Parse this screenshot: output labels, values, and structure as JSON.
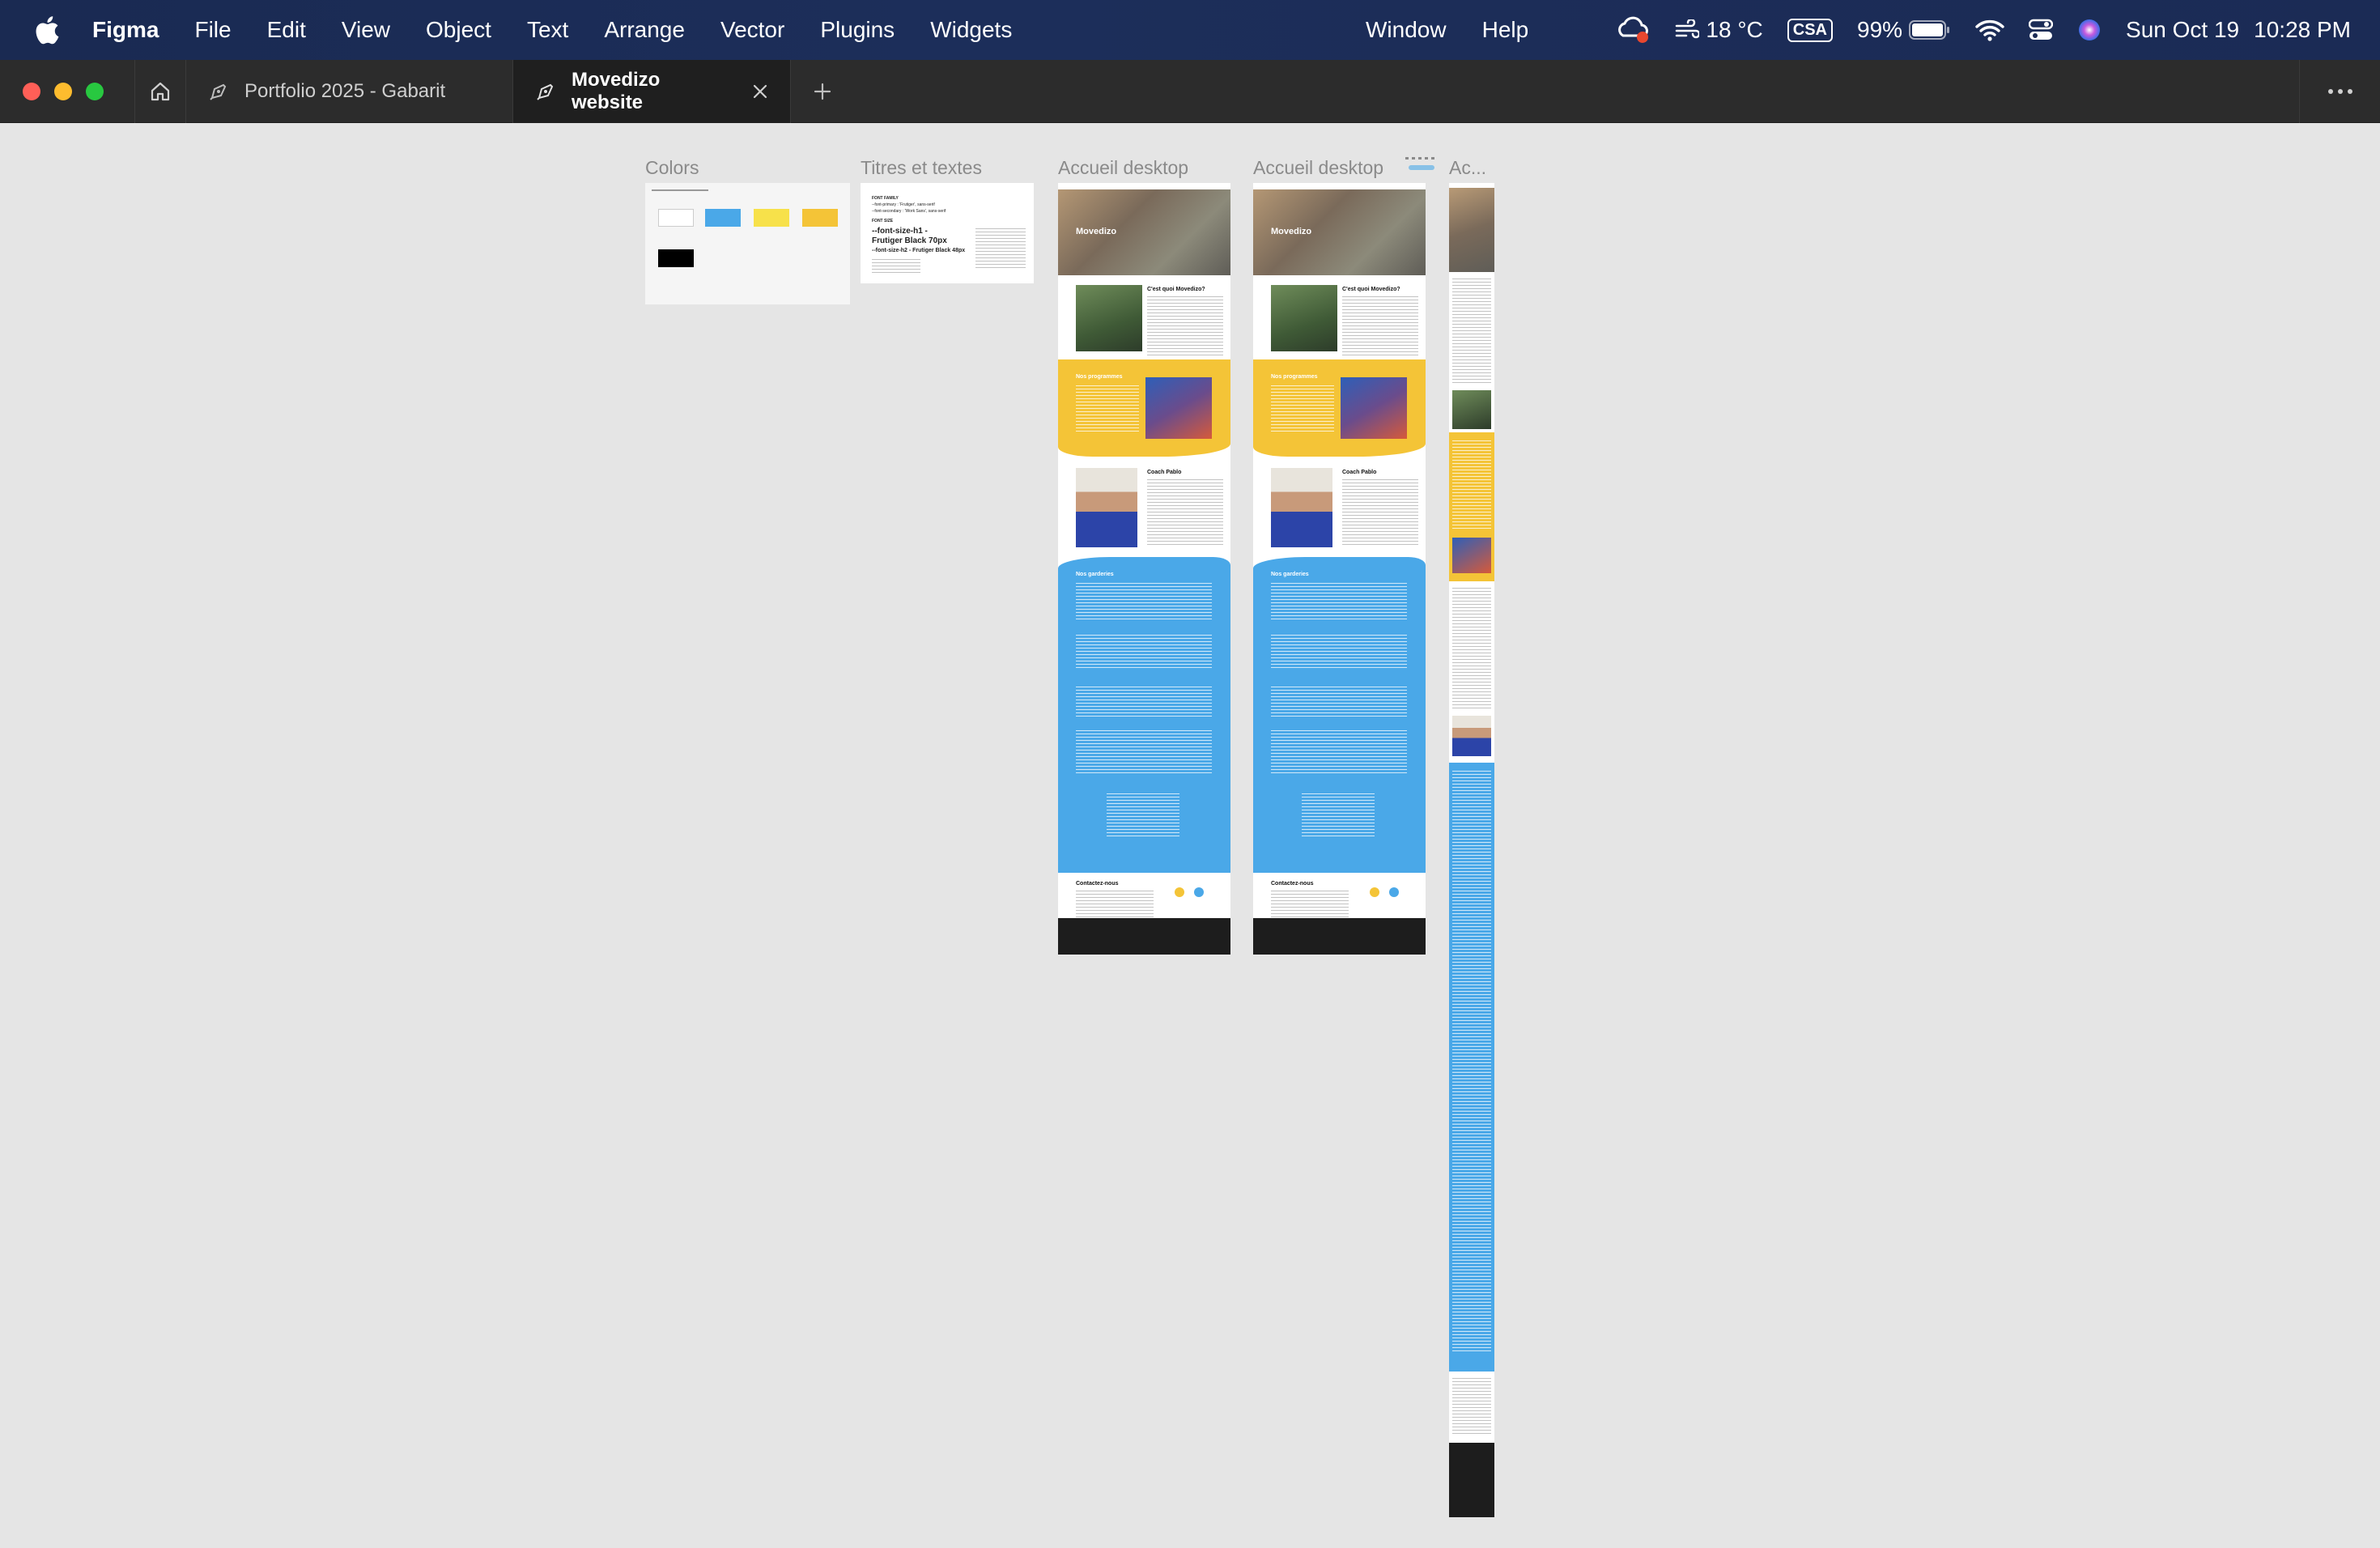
{
  "menubar": {
    "app_name": "Figma",
    "items": [
      "File",
      "Edit",
      "View",
      "Object",
      "Text",
      "Arrange",
      "Vector",
      "Plugins",
      "Widgets"
    ],
    "right_items": [
      "Window",
      "Help"
    ],
    "weather": "18 °C",
    "input_source": "CSA",
    "battery": "99%",
    "date": "Sun Oct 19",
    "time": "10:28 PM"
  },
  "tabs": [
    {
      "label": "Portfolio 2025 - Gabarit",
      "active": false
    },
    {
      "label": "Movedizo website",
      "active": true
    }
  ],
  "frames": {
    "colors": {
      "label": "Colors"
    },
    "titles": {
      "label": "Titres et textes",
      "lines": [
        "FONT FAMILY",
        "--font-primary : 'Frutiger', sans-serif",
        "--font-secondary : 'Work Sans', sans-serif",
        "FONT SIZE",
        "--font-size-h1 -",
        "Frutiger Black 70px",
        "--font-size-h2 - Frutiger Black 48px"
      ]
    },
    "desktop1": {
      "label": "Accueil desktop"
    },
    "desktop2": {
      "label": "Accueil desktop"
    },
    "mobile": {
      "label": "Ac..."
    }
  },
  "site": {
    "brand": "Movedizo",
    "about_title": "C'est quoi Movedizo?",
    "programs_title": "Nos programmes",
    "coach_title": "Coach Pablo",
    "daycares_title": "Nos garderies",
    "contact_title": "Contactez-nous"
  },
  "colors": {
    "accent_blue": "#4aa8e8",
    "accent_yellow": "#f4c437",
    "swatch_white": "#ffffff",
    "swatch_blue": "#4aa8e8",
    "swatch_yellow": "#f7e14a",
    "swatch_gold": "#f4c437",
    "swatch_black": "#000000"
  }
}
